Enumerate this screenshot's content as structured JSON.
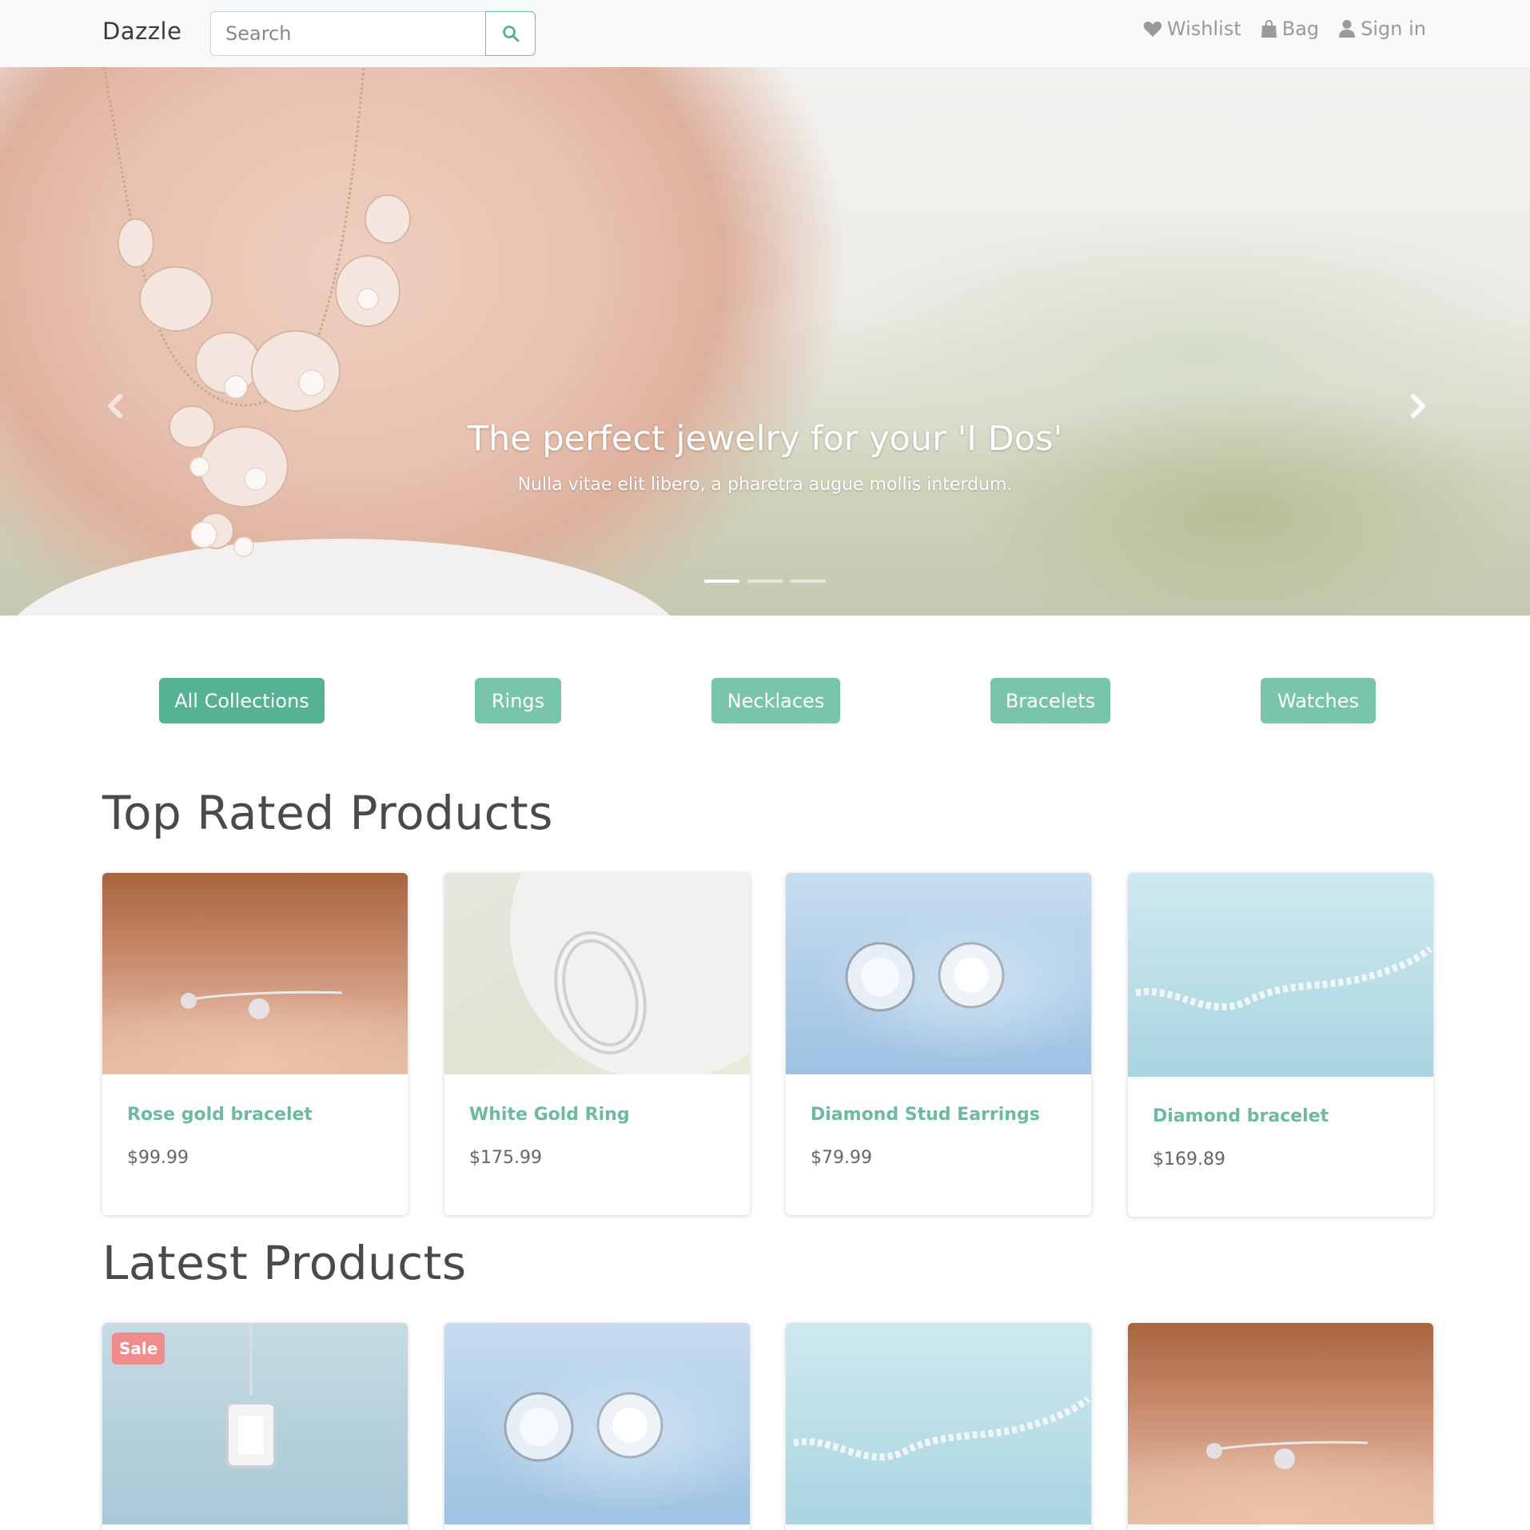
{
  "navbar": {
    "brand": "Dazzle",
    "search_placeholder": "Search",
    "links": [
      {
        "label": "Wishlist",
        "icon": "heart-icon"
      },
      {
        "label": "Bag",
        "icon": "bag-icon"
      },
      {
        "label": "Sign in",
        "icon": "user-icon"
      }
    ]
  },
  "hero": {
    "title": "The perfect jewelry for your 'I Dos'",
    "subtitle": "Nulla vitae elit libero, a pharetra augue mollis interdum.",
    "slide_count": 3,
    "active_slide": 1
  },
  "categories": [
    {
      "label": "All Collections",
      "active": true
    },
    {
      "label": "Rings",
      "active": false
    },
    {
      "label": "Necklaces",
      "active": false
    },
    {
      "label": "Bracelets",
      "active": false
    },
    {
      "label": "Watches",
      "active": false
    }
  ],
  "top_rated": {
    "title": "Top Rated Products",
    "products": [
      {
        "name": "Rose gold bracelet",
        "price": "$99.99"
      },
      {
        "name": "White Gold Ring",
        "price": "$175.99"
      },
      {
        "name": "Diamond Stud Earrings",
        "price": "$79.99"
      },
      {
        "name": "Diamond bracelet",
        "price": "$169.89"
      }
    ]
  },
  "latest": {
    "title": "Latest Products",
    "sale_badge": "Sale"
  },
  "colors": {
    "accent": "#6dbb9f",
    "button": "#78c5aa",
    "button_active": "#55b394",
    "sale": "#f08c8c"
  }
}
